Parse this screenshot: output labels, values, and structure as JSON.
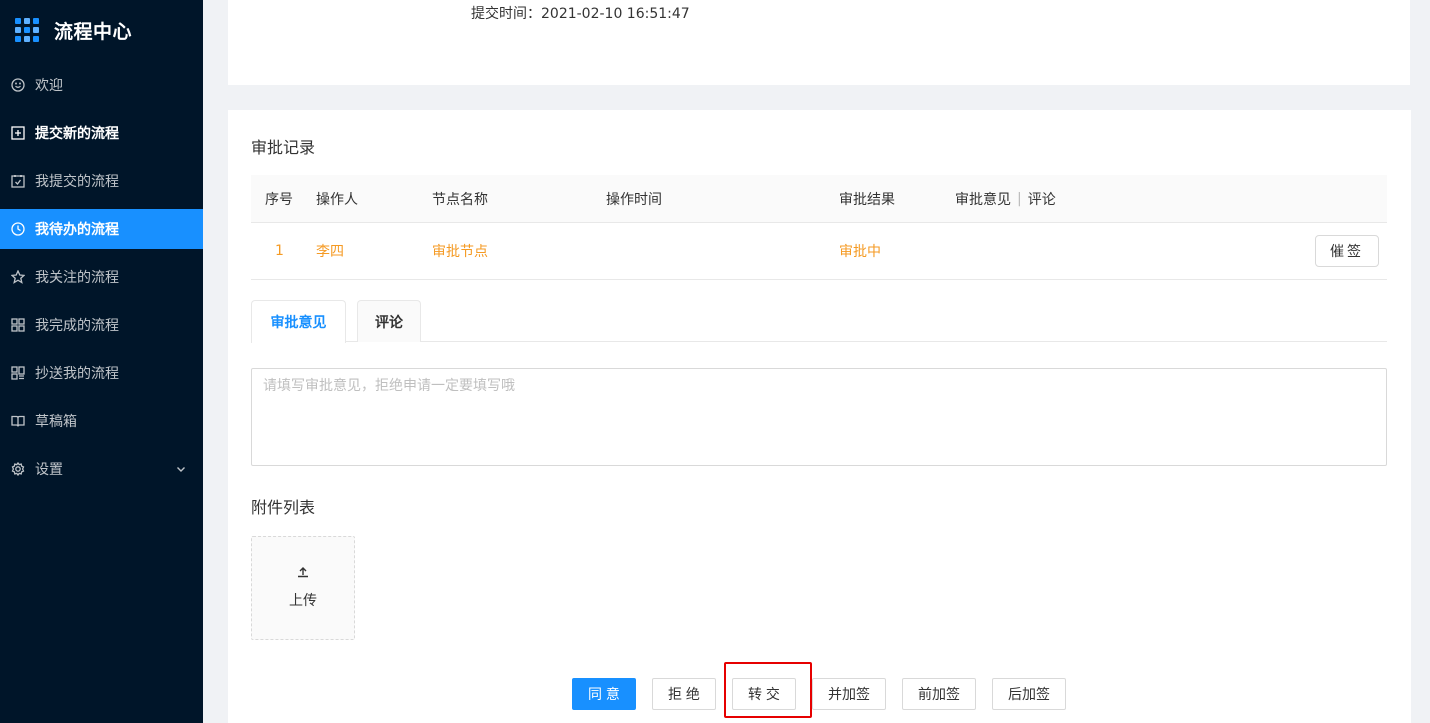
{
  "brand": {
    "title": "流程中心"
  },
  "sidebar": {
    "items": [
      {
        "label": "欢迎",
        "icon": "smile-icon"
      },
      {
        "label": "提交新的流程",
        "icon": "plus-square-icon"
      },
      {
        "label": "我提交的流程",
        "icon": "check-square-icon"
      },
      {
        "label": "我待办的流程",
        "icon": "clock-icon",
        "active": true
      },
      {
        "label": "我关注的流程",
        "icon": "star-icon"
      },
      {
        "label": "我完成的流程",
        "icon": "appstore-icon"
      },
      {
        "label": "抄送我的流程",
        "icon": "copy-grid-icon"
      },
      {
        "label": "草稿箱",
        "icon": "book-icon"
      },
      {
        "label": "设置",
        "icon": "gear-icon",
        "has_submenu": true
      }
    ]
  },
  "header_info": {
    "submit_time": "提交时间：2021-02-10 16:51:47"
  },
  "approval": {
    "title": "审批记录",
    "columns": [
      "序号",
      "操作人",
      "节点名称",
      "操作时间",
      "审批结果",
      "审批意见",
      "评论"
    ],
    "rows": [
      {
        "index": "1",
        "operator": "李四",
        "node": "审批节点",
        "time": "",
        "result": "审批中",
        "comment": ""
      }
    ],
    "remind_button": "催签"
  },
  "tabs": [
    {
      "label": "审批意见",
      "active": true
    },
    {
      "label": "评论",
      "active": false
    }
  ],
  "opinion": {
    "placeholder": "请填写审批意见，拒绝申请一定要填写哦",
    "value": ""
  },
  "attachments": {
    "title": "附件列表",
    "upload_label": "上传"
  },
  "actions": {
    "agree": "同 意",
    "reject": "拒 绝",
    "transfer": "转 交",
    "add_parallel": "并加签",
    "add_before": "前加签",
    "add_after": "后加签"
  },
  "colors": {
    "sidebar_bg": "#001529",
    "primary": "#1890ff",
    "status_orange": "#f59a23",
    "highlight_red": "#e60000"
  }
}
